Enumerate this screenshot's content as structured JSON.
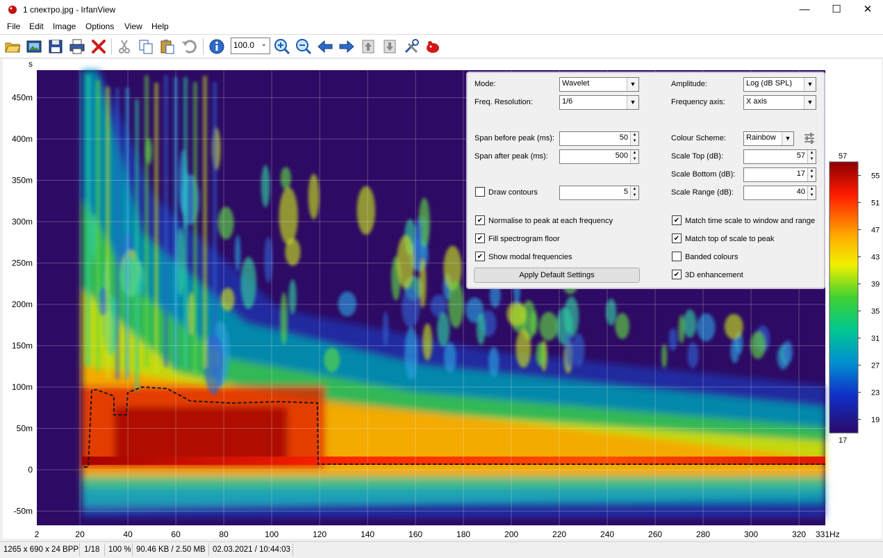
{
  "window": {
    "title": "1 спектро.jpg - IrfanView",
    "minimize": "—",
    "maximize": "☐",
    "close": "✕"
  },
  "menu": [
    "File",
    "Edit",
    "Image",
    "Options",
    "View",
    "Help"
  ],
  "toolbar": {
    "zoom_value": "100.0",
    "icons": [
      "open-folder-icon",
      "slideshow-icon",
      "save-icon",
      "print-icon",
      "delete-icon",
      "cut-icon",
      "copy-icon",
      "paste-icon",
      "undo-icon",
      "info-icon",
      "zoom-in-icon",
      "zoom-out-icon",
      "previous-icon",
      "next-icon",
      "page-up-icon",
      "page-down-icon",
      "settings-icon",
      "irfanview-logo-icon"
    ]
  },
  "panel": {
    "mode_label": "Mode:",
    "mode_value": "Wavelet",
    "freq_res_label": "Freq. Resolution:",
    "freq_res_value": "1/6",
    "amplitude_label": "Amplitude:",
    "amplitude_value": "Log (dB SPL)",
    "freq_axis_label": "Frequency axis:",
    "freq_axis_value": "X axis",
    "span_before_label": "Span before peak (ms):",
    "span_before_value": "50",
    "span_after_label": "Span after peak (ms):",
    "span_after_value": "500",
    "colour_scheme_label": "Colour Scheme:",
    "colour_scheme_value": "Rainbow",
    "scale_top_label": "Scale Top (dB):",
    "scale_top_value": "57",
    "scale_bottom_label": "Scale Bottom (dB):",
    "scale_bottom_value": "17",
    "scale_range_label": "Scale Range (dB):",
    "scale_range_value": "40",
    "draw_contours_label": "Draw contours",
    "draw_contours_value": "5",
    "normalise_label": "Normalise to peak at each frequency",
    "fill_floor_label": "Fill spectrogram floor",
    "modal_label": "Show modal frequencies",
    "match_time_label": "Match time scale to window and range",
    "match_top_label": "Match top of scale to peak",
    "banded_label": "Banded colours",
    "enhance_label": "3D enhancement",
    "apply_label": "Apply Default Settings"
  },
  "chart_data": {
    "type": "heatmap",
    "ylabel": "s",
    "x_unit_label": "331Hz",
    "x_ticks": [
      "2",
      "20",
      "40",
      "60",
      "80",
      "100",
      "120",
      "140",
      "160",
      "180",
      "200",
      "220",
      "240",
      "260",
      "280",
      "300",
      "320"
    ],
    "y_ticks": [
      "450m",
      "400m",
      "350m",
      "300m",
      "250m",
      "200m",
      "150m",
      "100m",
      "50m",
      "0",
      "-50m"
    ],
    "colorbar_top": "57",
    "colorbar_bottom": "17",
    "colorbar_ticks": [
      "55",
      "51",
      "47",
      "43",
      "39",
      "35",
      "31",
      "27",
      "23",
      "19"
    ]
  },
  "status": {
    "dims": "1265 x 690 x 24 BPP",
    "index": "1/18",
    "zoom": "100 %",
    "size": "90.46 KB / 2.50 MB",
    "datetime": "02.03.2021 / 10:44:03"
  }
}
